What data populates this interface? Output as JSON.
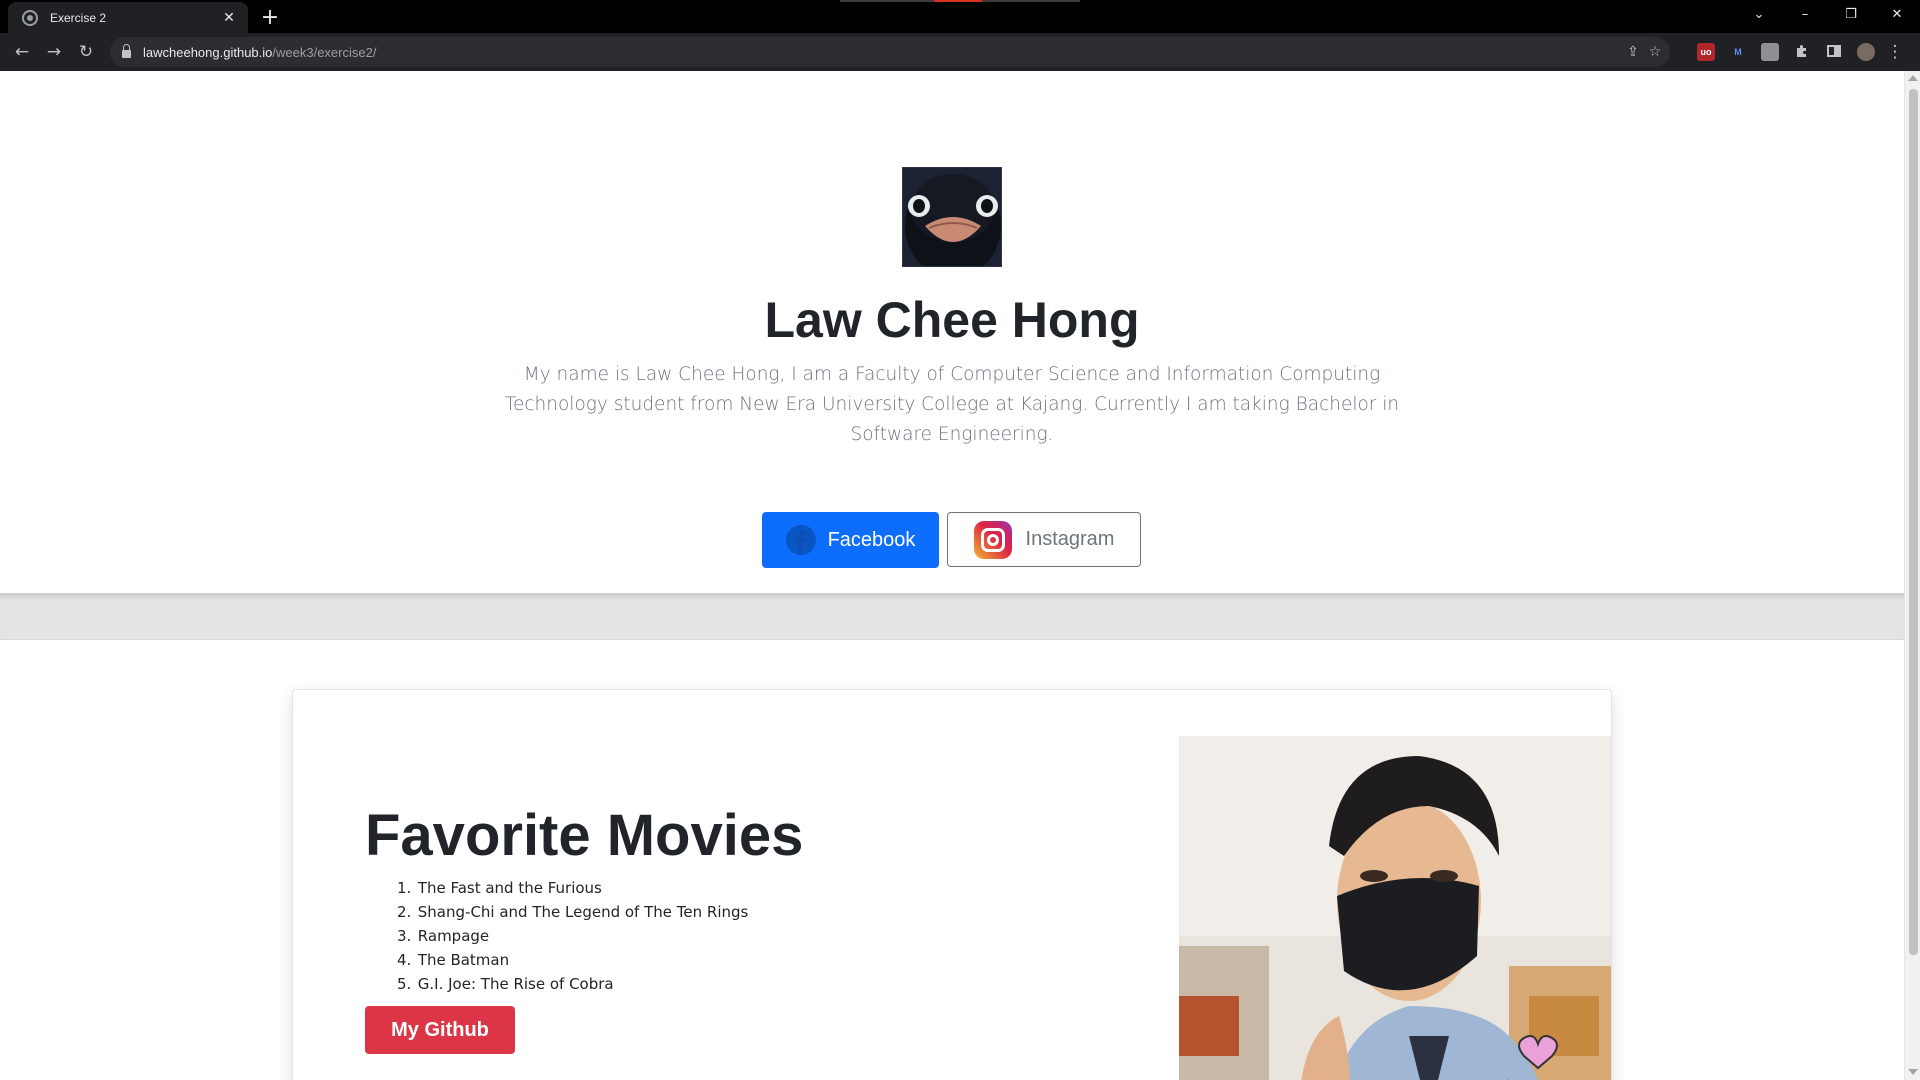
{
  "browser": {
    "tab_title": "Exercise 2",
    "tab_close": "✕",
    "new_tab": "+",
    "url_host": "lawcheehong.github.io",
    "url_path": "/week3/exercise2/",
    "window_controls": {
      "tabs_menu": "⌄",
      "minimize": "–",
      "restore": "❐",
      "close": "✕"
    },
    "nav": {
      "back": "←",
      "forward": "→",
      "reload": "↻",
      "menu": "⋮"
    },
    "extensions": {
      "ublock": "uo",
      "m": "M"
    }
  },
  "hero": {
    "name": "Law Chee Hong",
    "description": "My name is Law Chee Hong, I am a Faculty of Computer Science and Information Computing Technology student from New Era University College at Kajang. Currently I am taking Bachelor in Software Engineering.",
    "facebook_label": "Facebook",
    "instagram_label": "Instagram",
    "colors": {
      "facebook": "#0d6efd",
      "instagram_border": "#6c757d"
    }
  },
  "movies": {
    "title": "Favorite Movies",
    "items": [
      {
        "num": "1.",
        "title": "The Fast and the Furious"
      },
      {
        "num": "2.",
        "title": "Shang-Chi and The Legend of The Ten Rings"
      },
      {
        "num": "3.",
        "title": "Rampage"
      },
      {
        "num": "4.",
        "title": "The Batman"
      },
      {
        "num": "5.",
        "title": "G.I. Joe: The Rise of Cobra"
      }
    ],
    "github_label": "My Github",
    "colors": {
      "github": "#dc3545"
    }
  }
}
